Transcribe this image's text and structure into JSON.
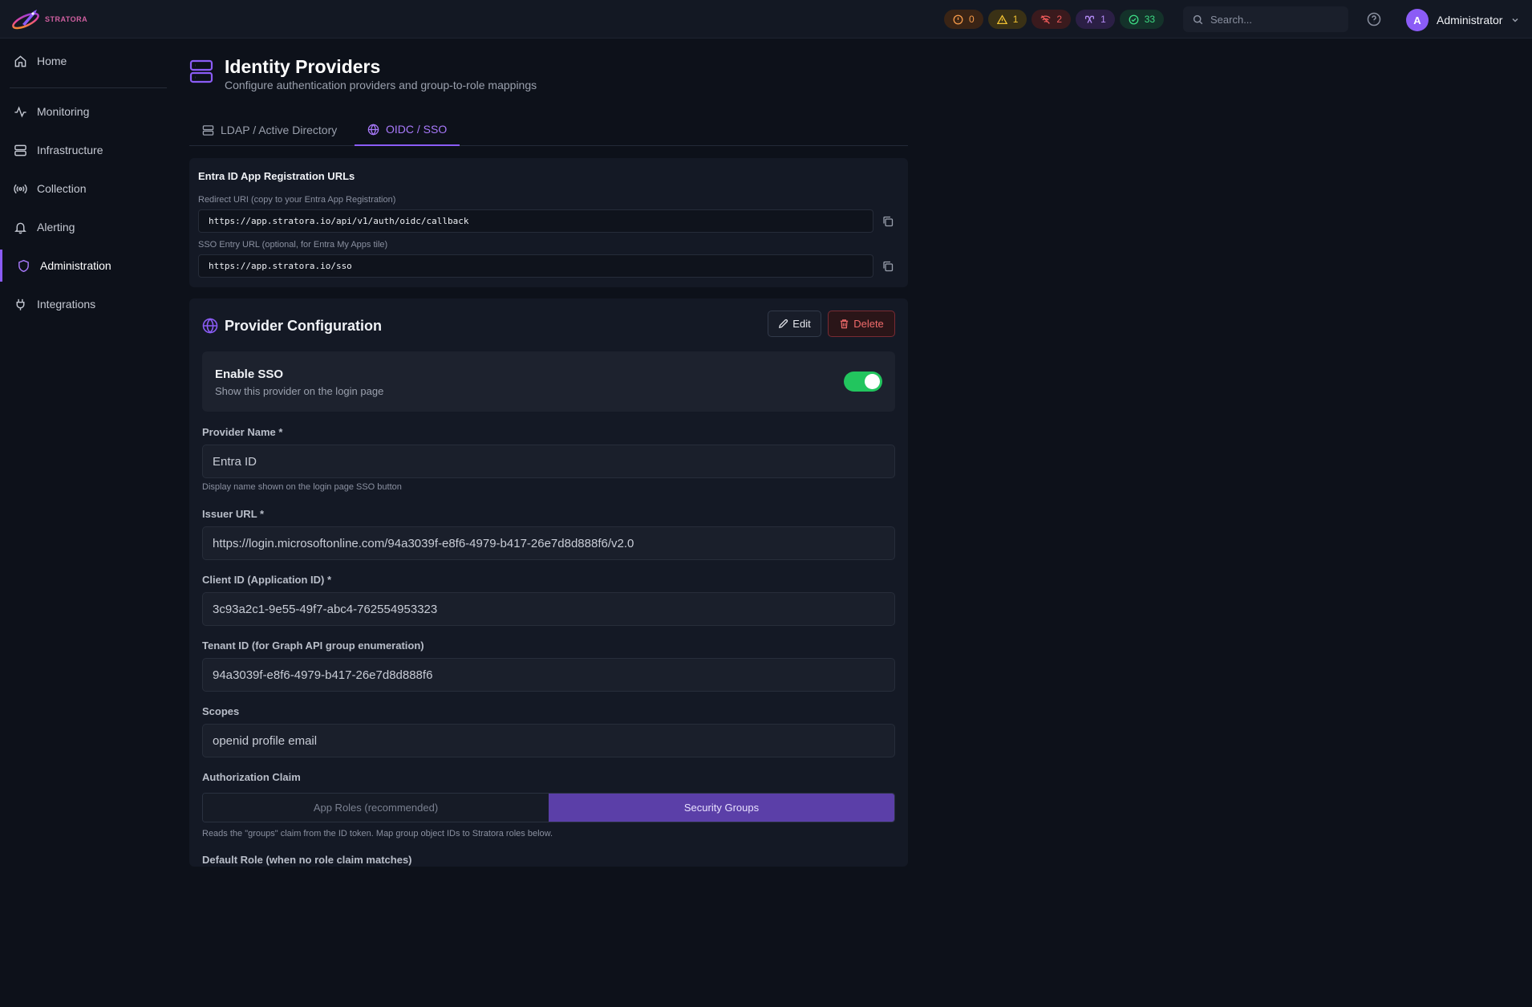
{
  "topbar": {
    "brand": "STRATORA",
    "badges": [
      {
        "icon": "alert-circle-icon",
        "count": "0",
        "color": "#f59a4a"
      },
      {
        "icon": "warning-triangle-icon",
        "count": "1",
        "color": "#f1c232"
      },
      {
        "icon": "wifi-off-icon",
        "count": "2",
        "color": "#ef5a5a"
      },
      {
        "icon": "network-icon",
        "count": "1",
        "color": "#b58cf8"
      },
      {
        "icon": "check-circle-icon",
        "count": "33",
        "color": "#3ddc84"
      }
    ],
    "search_placeholder": "Search...",
    "user": {
      "initial": "A",
      "name": "Administrator"
    }
  },
  "sidebar": {
    "items": [
      {
        "label": "Home",
        "icon": "home-icon"
      },
      {
        "label": "Monitoring",
        "icon": "activity-icon"
      },
      {
        "label": "Infrastructure",
        "icon": "server-icon"
      },
      {
        "label": "Collection",
        "icon": "broadcast-icon"
      },
      {
        "label": "Alerting",
        "icon": "bell-icon"
      },
      {
        "label": "Administration",
        "icon": "shield-icon",
        "active": true
      },
      {
        "label": "Integrations",
        "icon": "plug-icon"
      }
    ]
  },
  "page": {
    "title": "Identity Providers",
    "subtitle": "Configure authentication providers and group-to-role mappings"
  },
  "tabs": [
    {
      "label": "LDAP / Active Directory",
      "active": false
    },
    {
      "label": "OIDC / SSO",
      "active": true
    }
  ],
  "urls": {
    "title": "Entra ID App Registration URLs",
    "redirect_label": "Redirect URI (copy to your Entra App Registration)",
    "redirect_value": "https://app.stratora.io/api/v1/auth/oidc/callback",
    "sso_label": "SSO Entry URL (optional, for Entra My Apps tile)",
    "sso_value": "https://app.stratora.io/sso"
  },
  "provider": {
    "title": "Provider Configuration",
    "edit_label": "Edit",
    "delete_label": "Delete",
    "enable_sso_title": "Enable SSO",
    "enable_sso_sub": "Show this provider on the login page",
    "enable_sso_on": true,
    "fields": {
      "name_label": "Provider Name *",
      "name_value": "Entra ID",
      "name_hint": "Display name shown on the login page SSO button",
      "issuer_label": "Issuer URL *",
      "issuer_value": "https://login.microsoftonline.com/94a3039f-e8f6-4979-b417-26e7d8d888f6/v2.0",
      "client_label": "Client ID (Application ID) *",
      "client_value": "3c93a2c1-9e55-49f7-abc4-762554953323",
      "tenant_label": "Tenant ID (for Graph API group enumeration)",
      "tenant_value": "94a3039f-e8f6-4979-b417-26e7d8d888f6",
      "scopes_label": "Scopes",
      "scopes_value": "openid profile email"
    },
    "auth_claim_label": "Authorization Claim",
    "auth_claim_options": [
      "App Roles (recommended)",
      "Security Groups"
    ],
    "auth_claim_selected": "Security Groups",
    "auth_claim_hint": "Reads the \"groups\" claim from the ID token. Map group object IDs to Stratora roles below.",
    "default_role_label": "Default Role (when no role claim matches)"
  }
}
